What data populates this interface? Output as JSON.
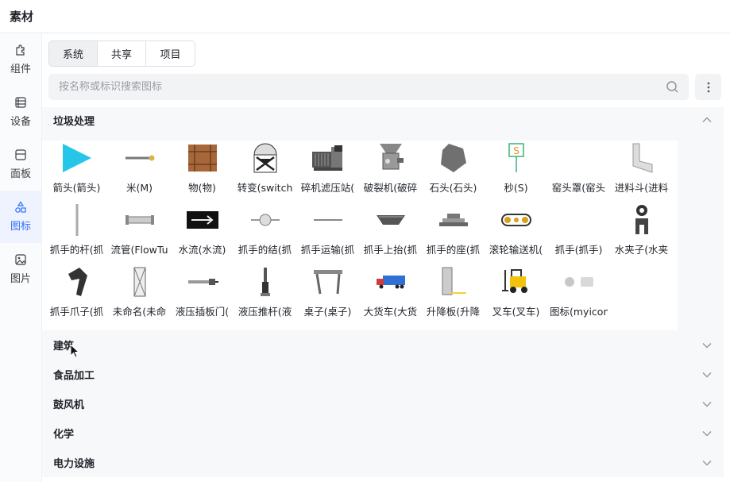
{
  "window": {
    "title": "素材"
  },
  "sidebar": {
    "items": [
      {
        "label": "组件",
        "icon": "puzzle-icon"
      },
      {
        "label": "设备",
        "icon": "device-icon"
      },
      {
        "label": "面板",
        "icon": "panel-icon"
      },
      {
        "label": "图标",
        "icon": "shapes-icon",
        "active": true
      },
      {
        "label": "图片",
        "icon": "image-icon"
      }
    ]
  },
  "tabs": [
    {
      "label": "系统",
      "active": true
    },
    {
      "label": "共享"
    },
    {
      "label": "项目"
    }
  ],
  "search": {
    "placeholder": "按名称或标识搜索图标"
  },
  "open_section": {
    "title": "垃圾处理",
    "items": [
      {
        "label": "箭头(箭头)",
        "icon": "arrow-icon"
      },
      {
        "label": "米(M)",
        "icon": "meter-icon"
      },
      {
        "label": "物(物)",
        "icon": "crate-icon"
      },
      {
        "label": "转变(switch",
        "icon": "switch-icon"
      },
      {
        "label": "碎机滤压站(",
        "icon": "filter-press-icon"
      },
      {
        "label": "破裂机(破碎",
        "icon": "crusher-icon"
      },
      {
        "label": "石头(石头)",
        "icon": "stone-icon"
      },
      {
        "label": "秒(S)",
        "icon": "s-sign-icon"
      },
      {
        "label": "窑头罩(窑头",
        "icon": "kiln-hood-icon"
      },
      {
        "label": "进料斗(进料",
        "icon": "feed-hopper-icon"
      },
      {
        "label": "抓手的杆(抓",
        "icon": "grab-rod-icon"
      },
      {
        "label": "流管(FlowTu",
        "icon": "flow-tube-icon"
      },
      {
        "label": "水流(水流)",
        "icon": "water-flow-icon"
      },
      {
        "label": "抓手的结(抓",
        "icon": "grab-knot-icon"
      },
      {
        "label": "抓手运输(抓",
        "icon": "grab-transport-icon"
      },
      {
        "label": "抓手上抬(抓",
        "icon": "grab-lift-icon"
      },
      {
        "label": "抓手的座(抓",
        "icon": "grab-seat-icon"
      },
      {
        "label": "滚轮输送机(",
        "icon": "roller-conveyor-icon"
      },
      {
        "label": "抓手(抓手)",
        "icon": "grab-icon"
      },
      {
        "label": "水夹子(水夹",
        "icon": "water-clamp-icon"
      },
      {
        "label": "抓手爪子(抓",
        "icon": "grab-claw-icon"
      },
      {
        "label": "未命名(未命",
        "icon": "unnamed-icon"
      },
      {
        "label": "液压插板门(",
        "icon": "hydraulic-gate-icon"
      },
      {
        "label": "液压推杆(液",
        "icon": "hydraulic-pushrod-icon"
      },
      {
        "label": "桌子(桌子)",
        "icon": "table-icon"
      },
      {
        "label": "大货车(大货",
        "icon": "truck-icon"
      },
      {
        "label": "升降板(升降",
        "icon": "lift-plate-icon"
      },
      {
        "label": "叉车(叉车)",
        "icon": "forklift-icon"
      },
      {
        "label": "图标(myicon",
        "icon": "myicon-icon"
      }
    ]
  },
  "collapsed_sections": [
    {
      "title": "建筑"
    },
    {
      "title": "食品加工"
    },
    {
      "title": "鼓风机"
    },
    {
      "title": "化学"
    },
    {
      "title": "电力设施"
    }
  ],
  "colors": {
    "accent": "#3370ff",
    "arrow": "#25c6e8",
    "truck": "#2f6fd6",
    "forklift": "#f2c20c"
  }
}
